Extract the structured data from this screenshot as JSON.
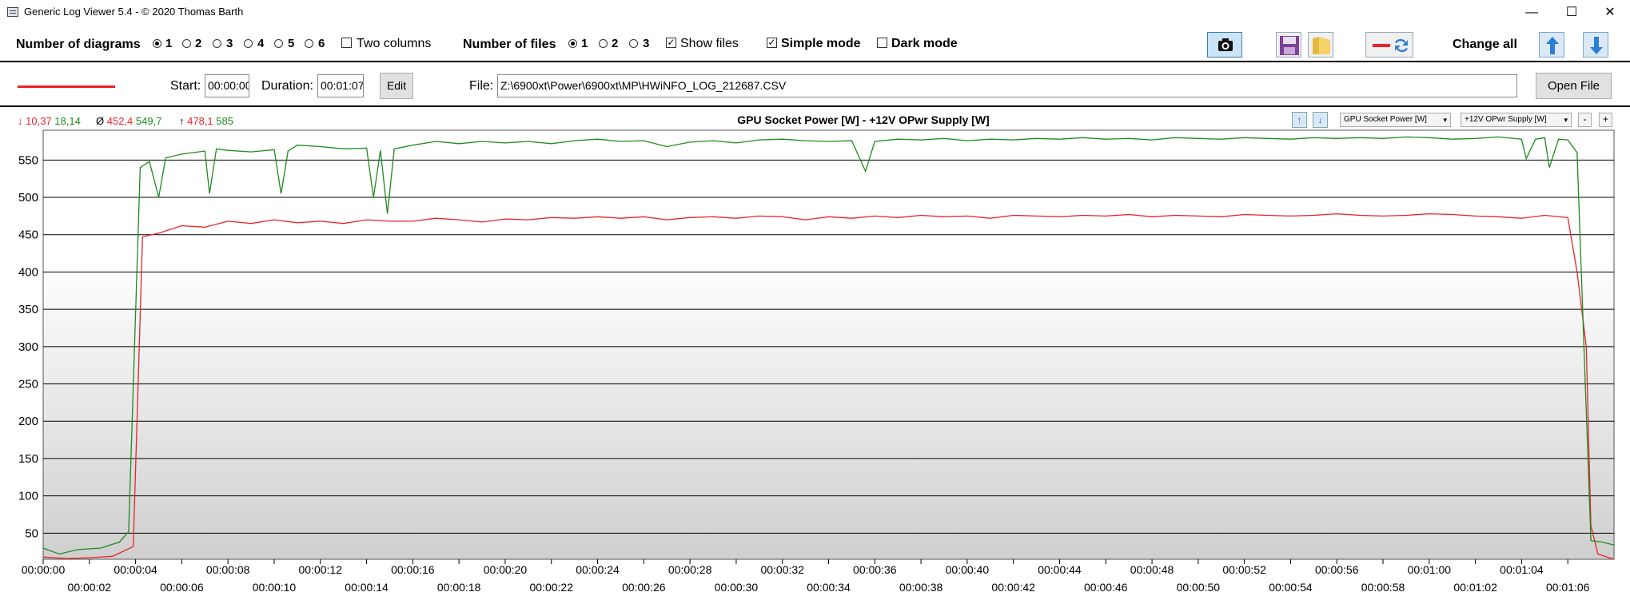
{
  "window": {
    "title": "Generic Log Viewer 5.4 - © 2020 Thomas Barth",
    "min": "—",
    "max": "☐",
    "close": "✕"
  },
  "toolbar": {
    "diagrams_label": "Number of diagrams",
    "diagram_options": [
      "1",
      "2",
      "3",
      "4",
      "5",
      "6"
    ],
    "diagram_selected": "1",
    "two_columns": "Two columns",
    "files_label": "Number of files",
    "file_options": [
      "1",
      "2",
      "3"
    ],
    "file_selected": "1",
    "show_files": "Show files",
    "simple_mode": "Simple mode",
    "dark_mode": "Dark mode",
    "change_all": "Change all",
    "icons": [
      "camera-icon",
      "save-icon",
      "folder-icon",
      "line-swap-icon",
      "arrow-up-icon",
      "arrow-down-icon"
    ]
  },
  "file_row": {
    "start_label": "Start:",
    "start_value": "00:00:00",
    "duration_label": "Duration:",
    "duration_value": "00:01:07",
    "edit_label": "Edit",
    "file_label": "File:",
    "file_path": "Z:\\6900xt\\Power\\6900xt\\MP\\HWiNFO_LOG_212687.CSV",
    "open_label": "Open File",
    "line_color": "#e8232a"
  },
  "stats": {
    "min_arrow": "↓",
    "min_red": "10,37",
    "min_green": "18,14",
    "avg_symbol": "Ø",
    "avg_red": "452,4",
    "avg_green": "549,7",
    "max_arrow": "↑",
    "max_red": "478,1",
    "max_green": "585"
  },
  "chart_header": {
    "title": "GPU Socket Power [W]  -  +12V OPwr Supply [W]",
    "dropdown1": "GPU Socket Power [W]",
    "dropdown2": "+12V OPwr Supply [W]",
    "minus": "-",
    "plus": "+"
  },
  "chart_data": {
    "type": "line",
    "ylim": [
      15,
      590
    ],
    "yticks": [
      50,
      100,
      150,
      200,
      250,
      300,
      350,
      400,
      450,
      500,
      550
    ],
    "xlim": [
      0,
      68
    ],
    "xtick_labels_top": [
      "00:00:00",
      "00:00:04",
      "00:00:08",
      "00:00:12",
      "00:00:16",
      "00:00:20",
      "00:00:24",
      "00:00:28",
      "00:00:32",
      "00:00:36",
      "00:00:40",
      "00:00:44",
      "00:00:48",
      "00:00:52",
      "00:00:56",
      "00:01:00",
      "00:01:04"
    ],
    "xtick_labels_bottom": [
      "00:00:02",
      "00:00:06",
      "00:00:10",
      "00:00:14",
      "00:00:18",
      "00:00:22",
      "00:00:26",
      "00:00:30",
      "00:00:34",
      "00:00:38",
      "00:00:42",
      "00:00:46",
      "00:00:50",
      "00:00:54",
      "00:00:58",
      "00:01:02",
      "00:01:06"
    ],
    "series": [
      {
        "name": "GPU Socket Power [W]",
        "color": "#e8232a",
        "points": [
          [
            0,
            18
          ],
          [
            1,
            16
          ],
          [
            2,
            17
          ],
          [
            3,
            19
          ],
          [
            3.9,
            32
          ],
          [
            4.3,
            447
          ],
          [
            5,
            452
          ],
          [
            6,
            462
          ],
          [
            7,
            460
          ],
          [
            8,
            468
          ],
          [
            9,
            465
          ],
          [
            10,
            470
          ],
          [
            11,
            466
          ],
          [
            12,
            468
          ],
          [
            13,
            465
          ],
          [
            14,
            470
          ],
          [
            15,
            468
          ],
          [
            16,
            468
          ],
          [
            17,
            472
          ],
          [
            18,
            470
          ],
          [
            19,
            467
          ],
          [
            20,
            471
          ],
          [
            21,
            470
          ],
          [
            22,
            473
          ],
          [
            23,
            472
          ],
          [
            24,
            474
          ],
          [
            25,
            472
          ],
          [
            26,
            474
          ],
          [
            27,
            470
          ],
          [
            28,
            473
          ],
          [
            29,
            474
          ],
          [
            30,
            472
          ],
          [
            31,
            475
          ],
          [
            32,
            474
          ],
          [
            33,
            470
          ],
          [
            34,
            474
          ],
          [
            35,
            472
          ],
          [
            36,
            475
          ],
          [
            37,
            473
          ],
          [
            38,
            476
          ],
          [
            39,
            474
          ],
          [
            40,
            475
          ],
          [
            41,
            472
          ],
          [
            42,
            476
          ],
          [
            43,
            475
          ],
          [
            44,
            474
          ],
          [
            45,
            476
          ],
          [
            46,
            475
          ],
          [
            47,
            477
          ],
          [
            48,
            474
          ],
          [
            49,
            476
          ],
          [
            50,
            475
          ],
          [
            51,
            474
          ],
          [
            52,
            477
          ],
          [
            53,
            476
          ],
          [
            54,
            475
          ],
          [
            55,
            476
          ],
          [
            56,
            478
          ],
          [
            57,
            476
          ],
          [
            58,
            475
          ],
          [
            59,
            476
          ],
          [
            60,
            478
          ],
          [
            61,
            477
          ],
          [
            62,
            475
          ],
          [
            63,
            474
          ],
          [
            64,
            472
          ],
          [
            65,
            476
          ],
          [
            66,
            473
          ],
          [
            66.4,
            400
          ],
          [
            66.8,
            300
          ],
          [
            67,
            60
          ],
          [
            67.3,
            22
          ],
          [
            68,
            15
          ]
        ]
      },
      {
        "name": "+12V OPwr Supply [W]",
        "color": "#1f8a1f",
        "points": [
          [
            0,
            30
          ],
          [
            0.7,
            22
          ],
          [
            1.5,
            28
          ],
          [
            2.5,
            30
          ],
          [
            3.3,
            38
          ],
          [
            3.7,
            52
          ],
          [
            4.2,
            540
          ],
          [
            4.6,
            548
          ],
          [
            5,
            500
          ],
          [
            5.3,
            553
          ],
          [
            6,
            558
          ],
          [
            7,
            562
          ],
          [
            7.2,
            505
          ],
          [
            7.5,
            565
          ],
          [
            8,
            563
          ],
          [
            9,
            561
          ],
          [
            10,
            564
          ],
          [
            10.3,
            505
          ],
          [
            10.6,
            562
          ],
          [
            11,
            570
          ],
          [
            12,
            568
          ],
          [
            13,
            565
          ],
          [
            14,
            566
          ],
          [
            14.3,
            500
          ],
          [
            14.6,
            563
          ],
          [
            14.9,
            478
          ],
          [
            15.2,
            565
          ],
          [
            16,
            570
          ],
          [
            17,
            575
          ],
          [
            18,
            572
          ],
          [
            19,
            575
          ],
          [
            20,
            573
          ],
          [
            21,
            575
          ],
          [
            22,
            572
          ],
          [
            23,
            576
          ],
          [
            24,
            578
          ],
          [
            25,
            575
          ],
          [
            26,
            576
          ],
          [
            27,
            568
          ],
          [
            28,
            574
          ],
          [
            29,
            576
          ],
          [
            30,
            573
          ],
          [
            31,
            577
          ],
          [
            32,
            578
          ],
          [
            33,
            576
          ],
          [
            34,
            575
          ],
          [
            35,
            576
          ],
          [
            35.6,
            535
          ],
          [
            36,
            575
          ],
          [
            37,
            578
          ],
          [
            38,
            577
          ],
          [
            39,
            579
          ],
          [
            40,
            576
          ],
          [
            41,
            578
          ],
          [
            42,
            577
          ],
          [
            43,
            579
          ],
          [
            44,
            578
          ],
          [
            45,
            580
          ],
          [
            46,
            578
          ],
          [
            47,
            579
          ],
          [
            48,
            577
          ],
          [
            49,
            580
          ],
          [
            50,
            579
          ],
          [
            51,
            578
          ],
          [
            52,
            580
          ],
          [
            53,
            579
          ],
          [
            54,
            578
          ],
          [
            55,
            580
          ],
          [
            56,
            579
          ],
          [
            57,
            580
          ],
          [
            58,
            579
          ],
          [
            59,
            581
          ],
          [
            60,
            580
          ],
          [
            61,
            578
          ],
          [
            62,
            579
          ],
          [
            63,
            581
          ],
          [
            64,
            578
          ],
          [
            64.2,
            552
          ],
          [
            64.6,
            578
          ],
          [
            65,
            580
          ],
          [
            65.2,
            540
          ],
          [
            65.6,
            578
          ],
          [
            66,
            577
          ],
          [
            66.4,
            560
          ],
          [
            66.7,
            300
          ],
          [
            67,
            40
          ],
          [
            67.5,
            38
          ],
          [
            68,
            34
          ]
        ]
      }
    ]
  }
}
